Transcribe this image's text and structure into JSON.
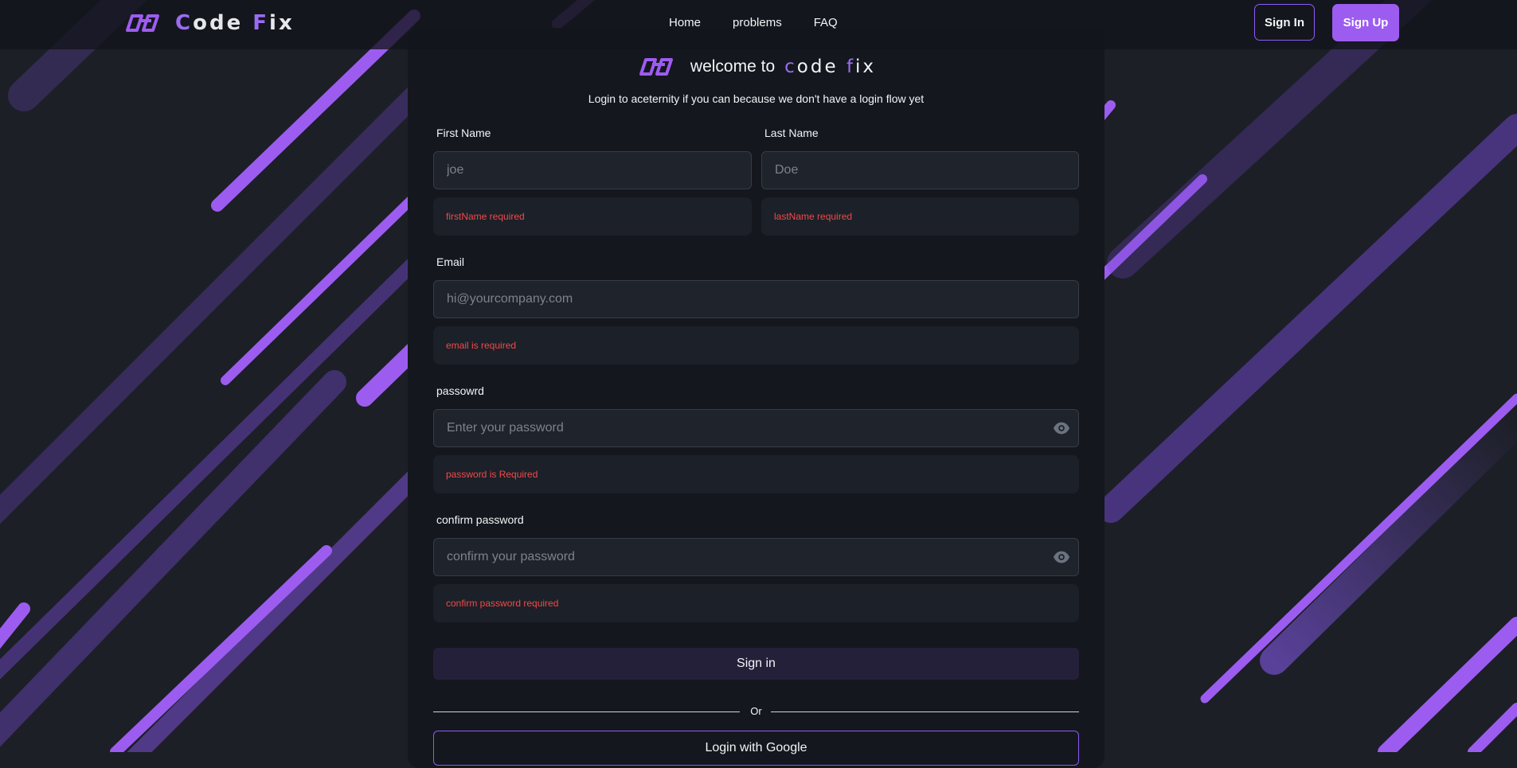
{
  "header": {
    "brand": {
      "first": "C",
      "first_rest": "ode ",
      "second": "F",
      "second_rest": "ix"
    },
    "nav": [
      "Home",
      "problems",
      "FAQ"
    ],
    "sign_in_label": "Sign In",
    "sign_up_label": "Sign Up"
  },
  "card": {
    "welcome": "welcome to",
    "brand": {
      "c": "c",
      "c_rest": "ode ",
      "f": "f",
      "f_rest": "ix"
    },
    "subtitle": "Login to aceternity if you can because we don't have a login flow yet"
  },
  "form": {
    "first_name": {
      "label": "First Name",
      "placeholder": "joe",
      "error": "firstName required"
    },
    "last_name": {
      "label": "Last Name",
      "placeholder": "Doe",
      "error": "lastName required"
    },
    "email": {
      "label": "Email",
      "placeholder": "hi@yourcompany.com",
      "error": "email is required"
    },
    "password": {
      "label": "passowrd",
      "placeholder": "Enter your password",
      "error": "password is Required"
    },
    "confirm_password": {
      "label": "confirm password",
      "placeholder": "confirm your password",
      "error": "confirm password required"
    },
    "submit_label": "Sign in",
    "divider_label": "Or",
    "google_label": "Login with Google"
  },
  "icons": {
    "logo": "infinity-link-icon",
    "password_toggle": "eye-icon"
  },
  "colors": {
    "accent": "#9d5cf0",
    "error": "#f04a4a",
    "background": "#1c1f26",
    "card": "#14171e"
  }
}
